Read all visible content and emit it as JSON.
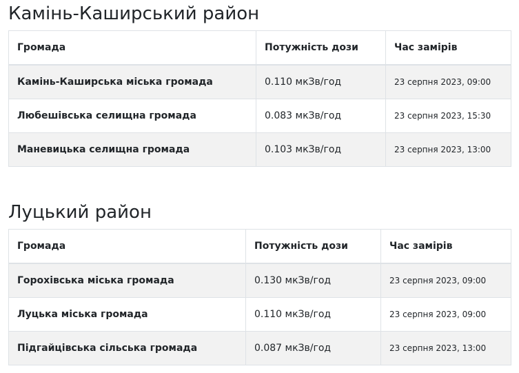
{
  "header_labels": {
    "community": "Громада",
    "dose": "Потужність дози",
    "time": "Час замірів"
  },
  "sections": [
    {
      "title": "Камінь-Каширський район",
      "rows": [
        {
          "community": "Камінь-Каширська міська громада",
          "dose": "0.110 мкЗв/год",
          "time": "23 серпня 2023, 09:00"
        },
        {
          "community": "Любешівська селищна громада",
          "dose": "0.083 мкЗв/год",
          "time": "23 серпня 2023, 15:30"
        },
        {
          "community": "Маневицька селищна громада",
          "dose": "0.103 мкЗв/год",
          "time": "23 серпня 2023, 13:00"
        }
      ]
    },
    {
      "title": "Луцький район",
      "rows": [
        {
          "community": "Горохівська міська громада",
          "dose": "0.130 мкЗв/год",
          "time": "23 серпня 2023, 09:00"
        },
        {
          "community": "Луцька міська громада",
          "dose": "0.110 мкЗв/год",
          "time": "23 серпня 2023, 09:00"
        },
        {
          "community": "Підгайцівська сільська громада",
          "dose": "0.087 мкЗв/год",
          "time": "23 серпня 2023, 13:00"
        }
      ]
    }
  ]
}
